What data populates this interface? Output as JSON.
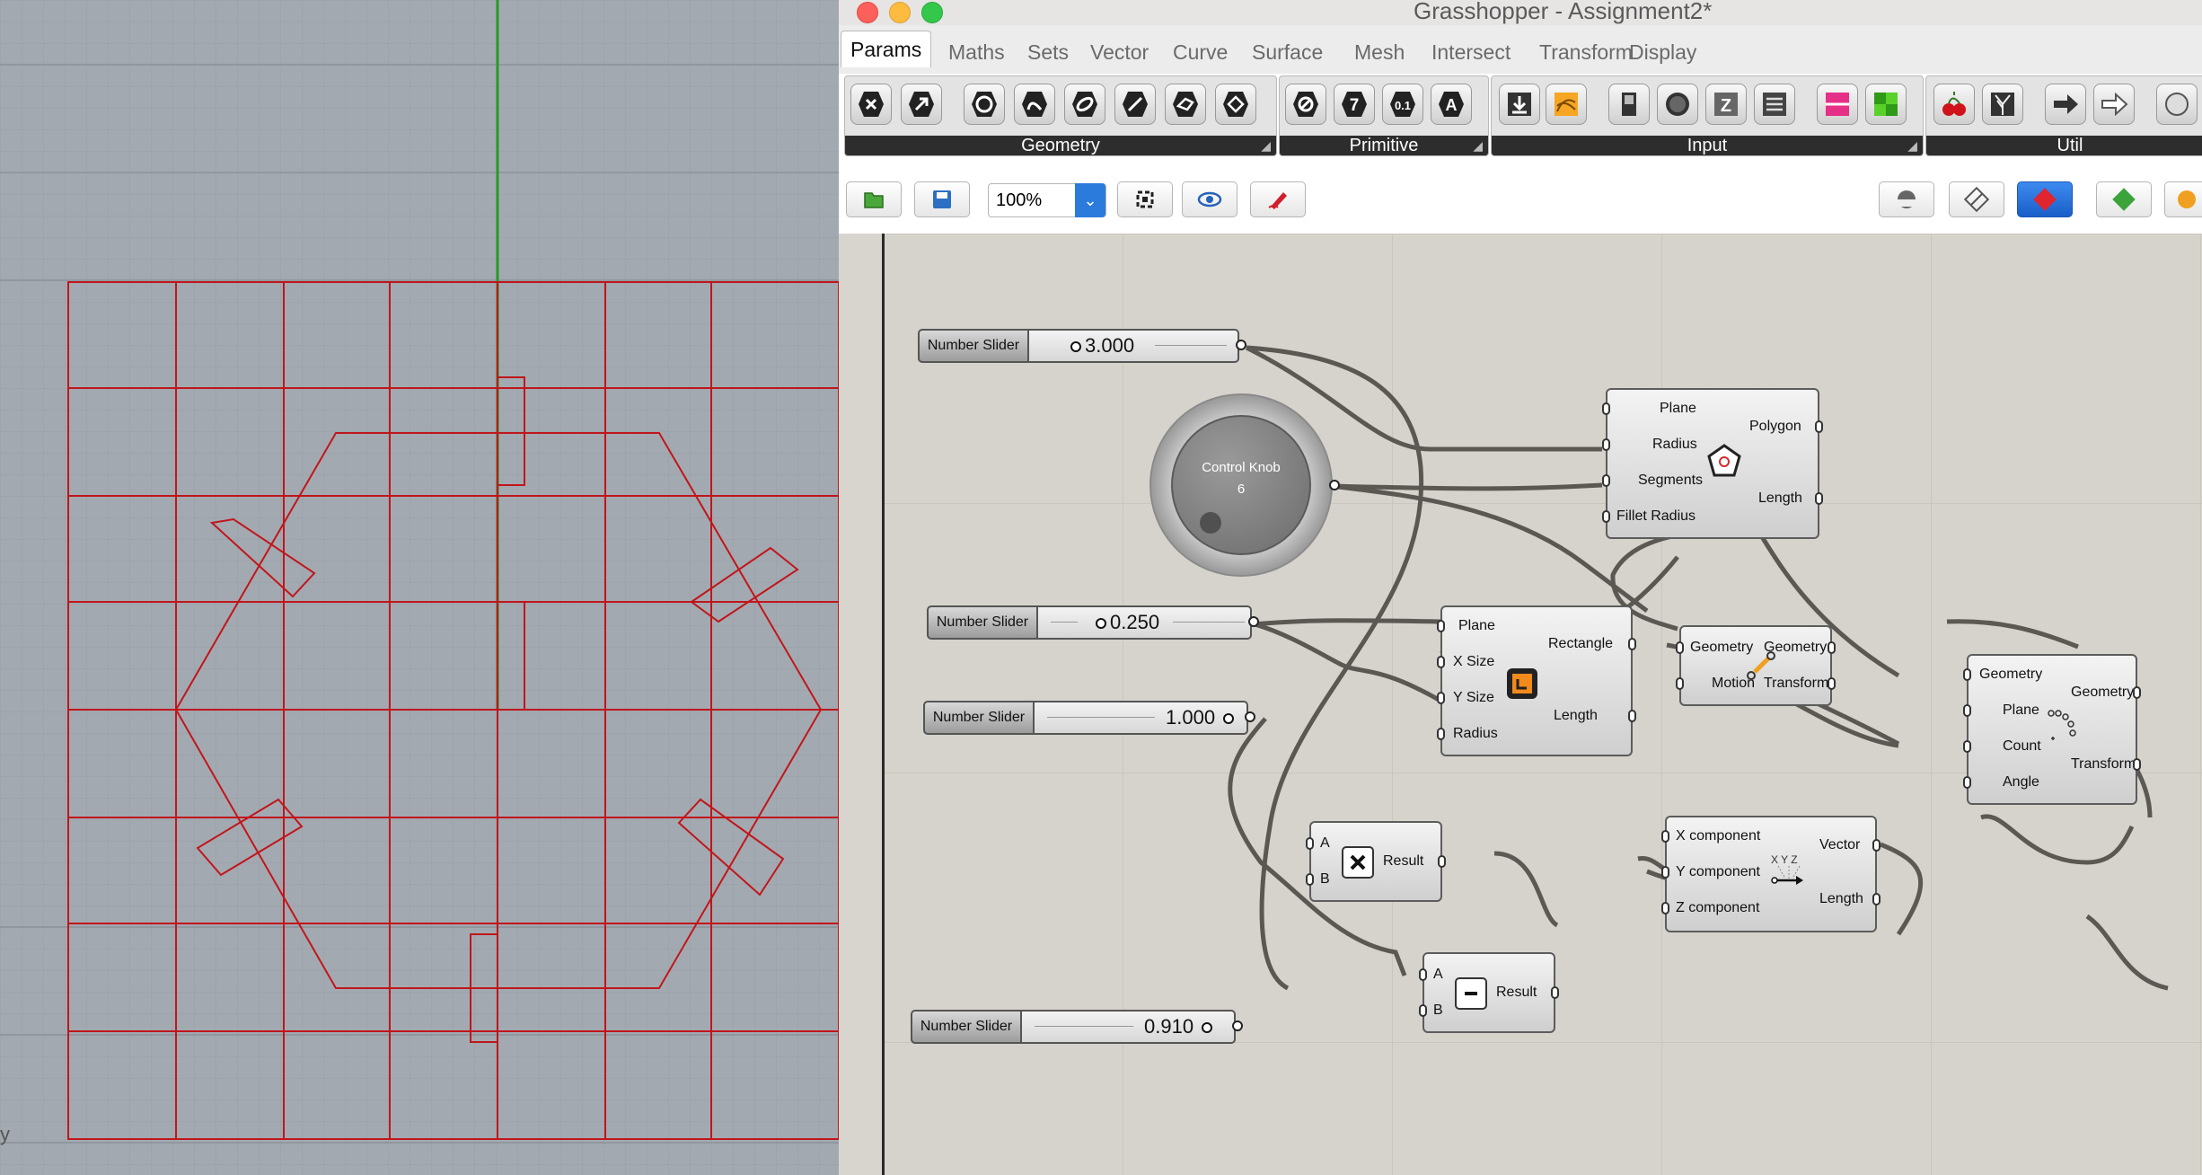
{
  "window": {
    "title": "Grasshopper - Assignment2*"
  },
  "tabs": [
    "Params",
    "Maths",
    "Sets",
    "Vector",
    "Curve",
    "Surface",
    "Mesh",
    "Intersect",
    "Transform",
    "Display"
  ],
  "ribbon": {
    "groups": [
      "Geometry",
      "Primitive",
      "Input",
      "Util"
    ]
  },
  "toolbar": {
    "zoom": "100%"
  },
  "viewport": {
    "axis_label": "y"
  },
  "canvas": {
    "sliders": [
      {
        "label": "Number Slider",
        "value": "3.000"
      },
      {
        "label": "Number Slider",
        "value": "0.250"
      },
      {
        "label": "Number Slider",
        "value": "1.000"
      },
      {
        "label": "Number Slider",
        "value": "0.910"
      }
    ],
    "knob": {
      "label": "Control Knob",
      "value": "6"
    },
    "polygon": {
      "inputs": [
        "Plane",
        "Radius",
        "Segments",
        "Fillet Radius"
      ],
      "outputs": [
        "Polygon",
        "Length"
      ]
    },
    "rectangle": {
      "inputs": [
        "Plane",
        "X Size",
        "Y Size",
        "Radius"
      ],
      "outputs": [
        "Rectangle",
        "Length"
      ]
    },
    "move": {
      "inputs": [
        "Geometry",
        "Motion"
      ],
      "outputs": [
        "Geometry",
        "Transform"
      ]
    },
    "polar": {
      "inputs": [
        "Geometry",
        "Plane",
        "Count",
        "Angle"
      ],
      "outputs": [
        "Geometry",
        "Transform"
      ]
    },
    "multiply": {
      "inputs": [
        "A",
        "B"
      ],
      "outputs": [
        "Result"
      ]
    },
    "subtract": {
      "inputs": [
        "A",
        "B"
      ],
      "outputs": [
        "Result"
      ]
    },
    "vector": {
      "inputs": [
        "X component",
        "Y component",
        "Z component"
      ],
      "outputs": [
        "Vector",
        "Length"
      ],
      "icon_text": "X Y Z"
    }
  },
  "colors": {
    "curve": "#c0161b",
    "axis_green": "#1e8a1e",
    "canvas": "#d6d3cc",
    "selected_tool": "#1f6fe0"
  }
}
